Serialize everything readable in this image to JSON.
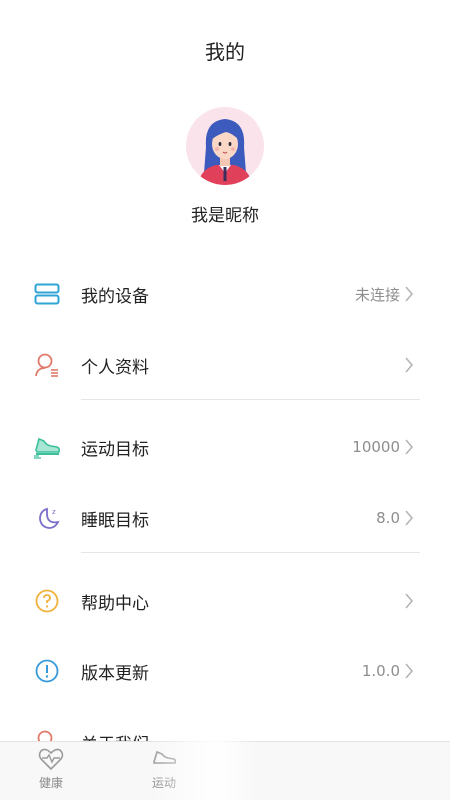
{
  "header": {
    "title": "我的"
  },
  "profile": {
    "nickname": "我是昵称"
  },
  "menu": [
    {
      "label": "我的设备",
      "value": "未连接",
      "icon": "device-icon",
      "color": "#2fa3d6"
    },
    {
      "label": "个人资料",
      "value": "",
      "icon": "user-profile-icon",
      "color": "#e07a6b"
    },
    {
      "label": "运动目标",
      "value": "10000",
      "icon": "sneaker-icon",
      "color": "#3dbf9b"
    },
    {
      "label": "睡眠目标",
      "value": "8.0",
      "icon": "moon-sleep-icon",
      "color": "#7a6fc9"
    },
    {
      "label": "帮助中心",
      "value": "",
      "icon": "help-icon",
      "color": "#f0b23c"
    },
    {
      "label": "版本更新",
      "value": "1.0.0",
      "icon": "info-exclamation-icon",
      "color": "#3a9ad9"
    },
    {
      "label": "关于我们",
      "value": "",
      "icon": "about-icon",
      "color": "#e07a6b"
    }
  ],
  "tabbar": {
    "tabs": [
      {
        "label": "健康",
        "icon": "heart-pulse-icon"
      },
      {
        "label": "运动",
        "icon": "sneaker-icon"
      }
    ]
  }
}
